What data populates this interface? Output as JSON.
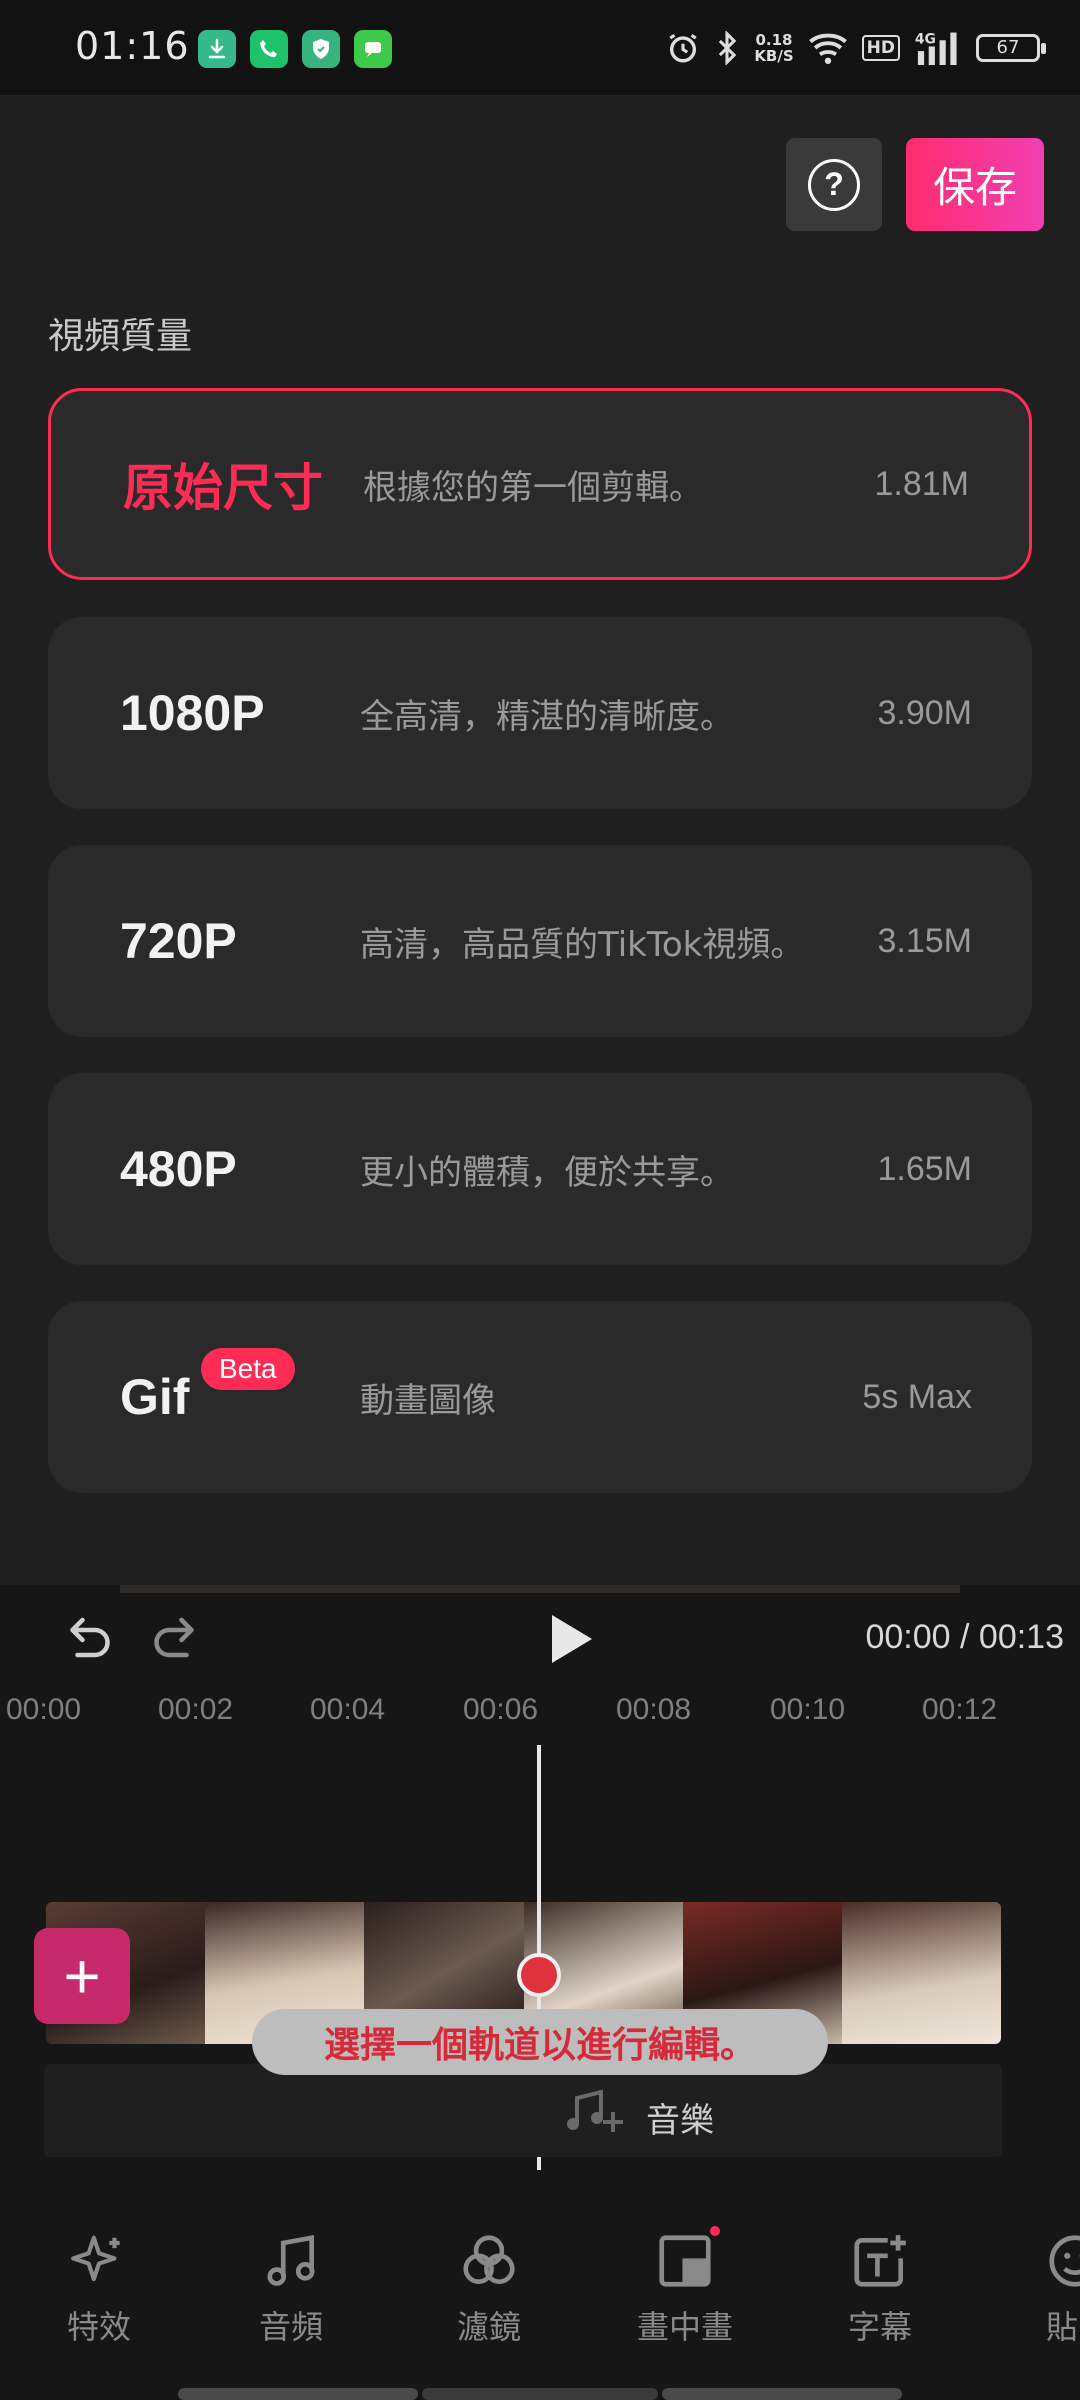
{
  "status_bar": {
    "time": "01:16",
    "speed_value": "0.18",
    "speed_unit": "KB/S",
    "hd_badge": "HD",
    "network": "4G",
    "battery": "67",
    "icons": [
      "download-icon",
      "phone-icon",
      "shield-icon",
      "messages-icon",
      "alarm-icon",
      "bluetooth-icon",
      "wifi-icon",
      "signal-icon"
    ]
  },
  "header": {
    "help_icon": "question-icon",
    "help_glyph": "?",
    "save_label": "保存",
    "save_colors": [
      "#fe2c6e",
      "#f23fb3"
    ]
  },
  "quality": {
    "section_label": "視頻質量",
    "options": [
      {
        "name": "原始尺寸",
        "description": "根據您的第一個剪輯。",
        "size": "1.81M",
        "selected": true
      },
      {
        "name": "1080P",
        "description": "全高清，精湛的清晰度。",
        "size": "3.90M",
        "selected": false
      },
      {
        "name": "720P",
        "description": "高清，高品質的TikTok視頻。",
        "size": "3.15M",
        "selected": false
      },
      {
        "name": "480P",
        "description": "更小的體積，便於共享。",
        "size": "1.65M",
        "selected": false
      },
      {
        "name": "Gif",
        "badge": "Beta",
        "description": "動畫圖像",
        "size": "5s Max",
        "selected": false
      }
    ],
    "accent_color": "#fe2c55"
  },
  "editor": {
    "timecode": "00:00 / 00:13",
    "ruler_ticks": [
      "00:00",
      "00:02",
      "00:04",
      "00:06",
      "00:08",
      "00:10",
      "00:12"
    ],
    "add_clip_glyph": "+",
    "tooltip": "選擇一個軌道以進行編輯。",
    "music_label": "音樂"
  },
  "toolbar": {
    "items": [
      {
        "label": "特效",
        "icon": "sparkle-icon"
      },
      {
        "label": "音頻",
        "icon": "music-note-icon"
      },
      {
        "label": "濾鏡",
        "icon": "filter-icon"
      },
      {
        "label": "畫中畫",
        "icon": "picture-in-picture-icon"
      },
      {
        "label": "字幕",
        "icon": "text-add-icon"
      },
      {
        "label": "貼",
        "icon": "sticker-icon"
      }
    ]
  }
}
